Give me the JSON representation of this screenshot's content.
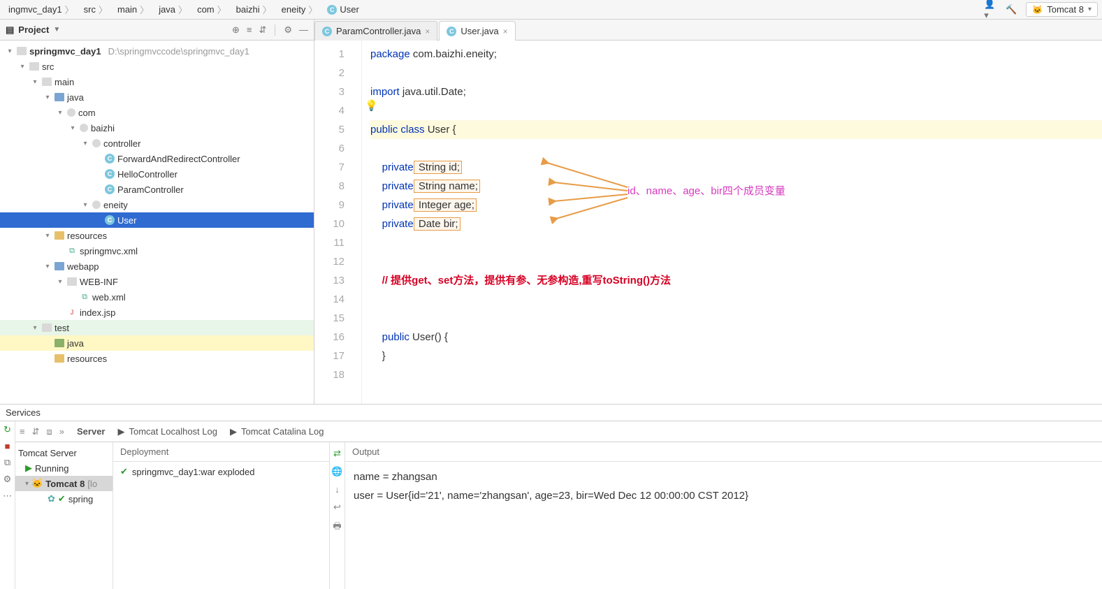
{
  "topbar": {
    "crumbs": [
      "ingmvc_day1",
      "src",
      "main",
      "java",
      "com",
      "baizhi",
      "eneity",
      "User"
    ],
    "run_config": "Tomcat 8"
  },
  "sidebar": {
    "title": "Project",
    "project": {
      "name": "springmvc_day1",
      "path": "D:\\springmvccode\\springmvc_day1"
    },
    "tree": {
      "src": "src",
      "main": "main",
      "java": "java",
      "com": "com",
      "baizhi": "baizhi",
      "controller": "controller",
      "c1": "ForwardAndRedirectController",
      "c2": "HelloController",
      "c3": "ParamController",
      "eneity": "eneity",
      "user": "User",
      "resources": "resources",
      "springxml": "springmvc.xml",
      "webapp": "webapp",
      "webinf": "WEB-INF",
      "webxml": "web.xml",
      "indexjsp": "index.jsp",
      "test": "test",
      "testjava": "java",
      "testres": "resources"
    }
  },
  "tabs": {
    "t1": "ParamController.java",
    "t2": "User.java"
  },
  "code": {
    "l1a": "package",
    "l1b": " com.baizhi.eneity;",
    "l3a": "import",
    "l3b": " java.util.Date;",
    "l5a": "public class ",
    "l5b": "User",
    "l5c": " {",
    "l7a": "    private",
    "l7b": " String id",
    "l7c": ";",
    "l8a": "    private",
    "l8b": " String name",
    "l8c": ";",
    "l9a": "    private",
    "l9b": " Integer age",
    "l9c": ";",
    "l10a": "    private",
    "l10b": " Date bir",
    "l10c": ";",
    "l13": "    // 提供get、set方法，提供有参、无参构造,重写toString()方法",
    "l16a": "    public ",
    "l16b": "User",
    "l16c": "() {",
    "l17": "    }"
  },
  "annotation": {
    "text": "id、name、age、bir四个成员变量"
  },
  "services": {
    "title": "Services",
    "tabs": {
      "server": "Server",
      "log1": "Tomcat Localhost Log",
      "log2": "Tomcat Catalina Log"
    },
    "tree": {
      "tomcat": "Tomcat Server",
      "running": "Running",
      "tomcat8": "Tomcat 8",
      "tomcat8_suffix": " [lo",
      "spring": "spring"
    },
    "deploy": {
      "head": "Deployment",
      "item": "springmvc_day1:war exploded"
    },
    "output": {
      "head": "Output",
      "line1": "name = zhangsan",
      "line2": "user = User{id='21', name='zhangsan', age=23, bir=Wed Dec 12 00:00:00 CST 2012}"
    }
  },
  "gutter": [
    "1",
    "2",
    "3",
    "4",
    "5",
    "6",
    "7",
    "8",
    "9",
    "10",
    "11",
    "12",
    "13",
    "14",
    "15",
    "16",
    "17",
    "18"
  ]
}
